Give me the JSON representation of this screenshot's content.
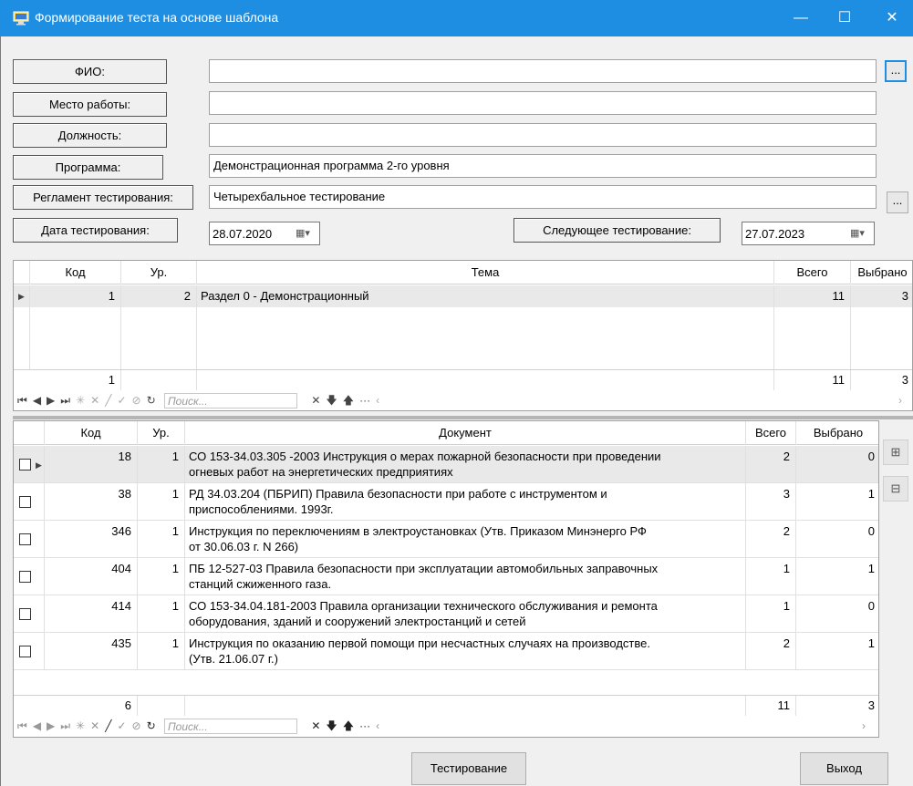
{
  "window": {
    "title": "Формирование теста на основе шаблона",
    "icon_name": "app-icon",
    "controls": {
      "minimize": "—",
      "maximize": "☐",
      "close": "✕"
    },
    "accent_color": "#1e8ee3"
  },
  "form": {
    "fio": {
      "label": "ФИО:",
      "value": ""
    },
    "workplace": {
      "label": "Место работы:",
      "value": ""
    },
    "position": {
      "label": "Должность:",
      "value": ""
    },
    "program": {
      "label": "Программа:",
      "value": "Демонстрационная программа 2-го уровня"
    },
    "regulation": {
      "label": "Регламент тестирования:",
      "value": "Четырехбальное тестирование"
    },
    "test_date": {
      "label": "Дата тестирования:",
      "value": "28.07.2020"
    },
    "next_test": {
      "label": "Следующее тестирование:",
      "value": "27.07.2023"
    },
    "ellipsis": "..."
  },
  "topics_grid": {
    "headers": {
      "code": "Код",
      "level": "Ур.",
      "topic": "Тема",
      "total": "Всего",
      "selected": "Выбрано"
    },
    "rows": [
      {
        "code": "1",
        "level": "2",
        "topic": "Раздел 0 - Демонстрационный",
        "total": "11",
        "selected": "3"
      }
    ],
    "footer": {
      "code": "1",
      "total": "11",
      "selected": "3"
    },
    "search_placeholder": "Поиск..."
  },
  "docs_grid": {
    "headers": {
      "code": "Код",
      "level": "Ур.",
      "document": "Документ",
      "total": "Всего",
      "selected": "Выбрано"
    },
    "rows": [
      {
        "code": "18",
        "level": "1",
        "doc1": "СО 153-34.03.305 -2003 Инструкция о мерах пожарной безопасности при проведении",
        "doc2": "огневых работ на энергетических предприятиях",
        "total": "2",
        "selected": "0"
      },
      {
        "code": "38",
        "level": "1",
        "doc1": "РД 34.03.204 (ПБРИП) Правила безопасности при работе с инструментом и",
        "doc2": "приспособлениями. 1993г.",
        "total": "3",
        "selected": "1"
      },
      {
        "code": "346",
        "level": "1",
        "doc1": "Инструкция по переключениям в электроустановках (Утв. Приказом Минэнерго РФ",
        "doc2": "от 30.06.03 г. N 266)",
        "total": "2",
        "selected": "0"
      },
      {
        "code": "404",
        "level": "1",
        "doc1": "ПБ 12-527-03 Правила безопасности при эксплуатации автомобильных заправочных",
        "doc2": "станций сжиженного газа.",
        "total": "1",
        "selected": "1"
      },
      {
        "code": "414",
        "level": "1",
        "doc1": "СО 153-34.04.181-2003 Правила организации технического обслуживания и ремонта",
        "doc2": "оборудования, зданий и сооружений электростанций и сетей",
        "total": "1",
        "selected": "0"
      },
      {
        "code": "435",
        "level": "1",
        "doc1": "Инструкция по оказанию первой помощи при несчастных случаях на производстве.",
        "doc2": "(Утв. 21.06.07 г.)",
        "total": "2",
        "selected": "1"
      }
    ],
    "footer": {
      "code": "6",
      "total": "11",
      "selected": "3"
    },
    "search_placeholder": "Поиск..."
  },
  "buttons": {
    "testing": "Тестирование",
    "exit": "Выход"
  }
}
